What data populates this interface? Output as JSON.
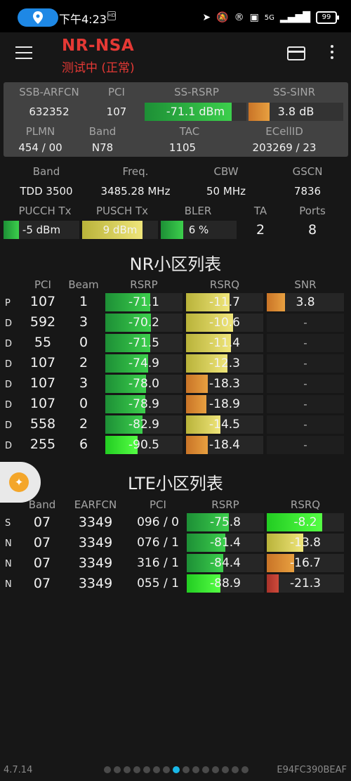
{
  "status": {
    "time": "下午4:23",
    "hd_badge": "HD",
    "battery": "99",
    "net": "5G"
  },
  "app": {
    "title": "NR-NSA",
    "subtitle": "测试中 (正常)"
  },
  "panel": {
    "row1_headers": [
      "SSB-ARFCN",
      "PCI",
      "SS-RSRP",
      "SS-SINR"
    ],
    "ssb_arfcn": "632352",
    "pci": "107",
    "ss_rsrp": "-71.1 dBm",
    "ss_sinr": "3.8 dB",
    "row2_headers": [
      "PLMN",
      "Band",
      "TAC",
      "ECellID"
    ],
    "plmn": "454 / 00",
    "band": "N78",
    "tac": "1105",
    "ecellid": "203269 / 23"
  },
  "info": {
    "row1_headers": [
      "Band",
      "Freq.",
      "CBW",
      "GSCN"
    ],
    "band": "TDD 3500",
    "freq": "3485.28 MHz",
    "cbw": "50 MHz",
    "gscn": "7836",
    "row2_headers": [
      "PUCCH Tx",
      "PUSCH Tx",
      "BLER",
      "TA",
      "Ports"
    ],
    "pucch": "-5 dBm",
    "pusch": "9 dBm",
    "bler": "6 %",
    "ta": "2",
    "ports": "8"
  },
  "nr": {
    "title": "NR小区列表",
    "headers": [
      "PCI",
      "Beam",
      "RSRP",
      "RSRQ",
      "SNR"
    ],
    "rows": [
      {
        "tag": "P",
        "pci": "107",
        "beam": "1",
        "rsrp": "-71.1",
        "rsrq": "-11.7",
        "snr": "3.8"
      },
      {
        "tag": "D",
        "pci": "592",
        "beam": "3",
        "rsrp": "-70.2",
        "rsrq": "-10.6",
        "snr": "-"
      },
      {
        "tag": "D",
        "pci": "55",
        "beam": "0",
        "rsrp": "-71.5",
        "rsrq": "-11.4",
        "snr": "-"
      },
      {
        "tag": "D",
        "pci": "107",
        "beam": "2",
        "rsrp": "-74.9",
        "rsrq": "-12.3",
        "snr": "-"
      },
      {
        "tag": "D",
        "pci": "107",
        "beam": "3",
        "rsrp": "-78.0",
        "rsrq": "-18.3",
        "snr": "-"
      },
      {
        "tag": "D",
        "pci": "107",
        "beam": "0",
        "rsrp": "-78.9",
        "rsrq": "-18.9",
        "snr": "-"
      },
      {
        "tag": "D",
        "pci": "558",
        "beam": "2",
        "rsrp": "-82.9",
        "rsrq": "-14.5",
        "snr": "-"
      },
      {
        "tag": "D",
        "pci": "255",
        "beam": "6",
        "rsrp": "-90.5",
        "rsrq": "-18.4",
        "snr": "-"
      }
    ]
  },
  "lte": {
    "title": "LTE小区列表",
    "headers": [
      "Band",
      "EARFCN",
      "PCI",
      "RSRP",
      "RSRQ"
    ],
    "rows": [
      {
        "tag": "S",
        "band": "07",
        "earfcn": "3349",
        "pci": "096 / 0",
        "rsrp": "-75.8",
        "rsrq": "-8.2"
      },
      {
        "tag": "N",
        "band": "07",
        "earfcn": "3349",
        "pci": "076 / 1",
        "rsrp": "-81.4",
        "rsrq": "-13.8"
      },
      {
        "tag": "N",
        "band": "07",
        "earfcn": "3349",
        "pci": "316 / 1",
        "rsrp": "-84.4",
        "rsrq": "-16.7"
      },
      {
        "tag": "N",
        "band": "07",
        "earfcn": "3349",
        "pci": "055 / 1",
        "rsrp": "-88.9",
        "rsrq": "-21.3"
      }
    ]
  },
  "footer": {
    "version": "4.7.14",
    "device_id": "E94FC390BEAF",
    "page_count": 15,
    "active_page": 7
  },
  "colors": {
    "green": "#2bb34a",
    "bright_green": "#33dd33",
    "yellow": "#d8d84a",
    "orange": "#e08a30",
    "red": "#c23b32",
    "accent": "#e53935"
  }
}
